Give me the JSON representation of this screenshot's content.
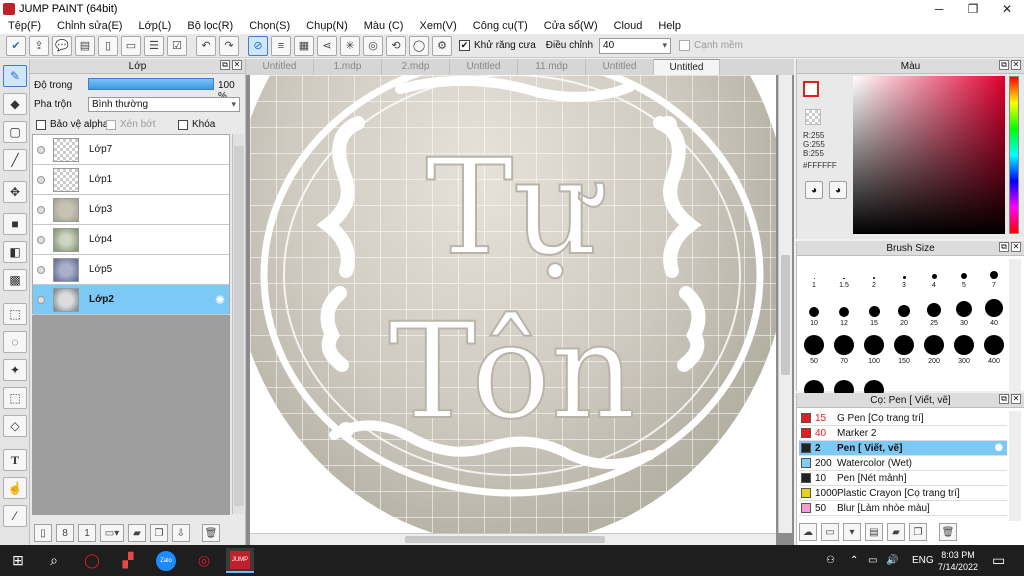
{
  "window": {
    "title": "JUMP PAINT (64bit)",
    "controls": [
      "─",
      "❐",
      "✕"
    ]
  },
  "menu": [
    "Tệp(F)",
    "Chỉnh sửa(E)",
    "Lớp(L)",
    "Bộ lọc(R)",
    "Chọn(S)",
    "Chụp(N)",
    "Màu (C)",
    "Xem(V)",
    "Công cụ(T)",
    "Cửa sổ(W)",
    "Cloud",
    "Help"
  ],
  "toolbar": {
    "antialias_label": "Khử răng cưa",
    "adjust_label": "Điều chỉnh",
    "adjust_value": "40",
    "smooth_edge_label": "Cạnh mềm"
  },
  "layer_panel": {
    "title": "Lớp",
    "opacity_label": "Độ trong",
    "opacity_value": "100 %",
    "opacity_fraction": 1.0,
    "blend_label": "Pha trộn",
    "blend_value": "Bình thường",
    "protect_alpha": "Bảo vệ alpha",
    "clip": "Xén bớt",
    "lock": "Khóa",
    "layers": [
      {
        "name": "Lớp7",
        "selected": false
      },
      {
        "name": "Lớp1",
        "selected": false
      },
      {
        "name": "Lớp3",
        "selected": false
      },
      {
        "name": "Lớp4",
        "selected": false
      },
      {
        "name": "Lớp5",
        "selected": false
      },
      {
        "name": "Lớp2",
        "selected": true
      }
    ]
  },
  "doc_tabs": [
    "Untitled",
    "1.mdp",
    "2.mdp",
    "Untitled",
    "11.mdp",
    "Untitled",
    "Untitled"
  ],
  "canvas_text": {
    "line1": "Tự",
    "line2": "Tôn"
  },
  "color_panel": {
    "title": "Màu",
    "r": "R:255",
    "g": "G:255",
    "b": "B:255",
    "hex": "#FFFFFF",
    "primary_color": "#FFFFFF",
    "accent": "#E02020"
  },
  "brush_panel": {
    "title": "Brush Size",
    "sizes": [
      "1",
      "1.5",
      "2",
      "3",
      "4",
      "5",
      "7",
      "10",
      "12",
      "15",
      "20",
      "25",
      "30",
      "40",
      "50",
      "70",
      "100",
      "150",
      "200",
      "300",
      "400",
      "",
      "",
      ""
    ]
  },
  "pen_panel": {
    "title": "Cọ: Pen [ Viết, vẽ]",
    "items": [
      {
        "size": "15",
        "name": "G Pen [Cọ trang trí]",
        "color": "#e02020",
        "selected": false
      },
      {
        "size": "40",
        "name": "Marker 2",
        "color": "#e02020",
        "selected": false
      },
      {
        "size": "2",
        "name": "Pen [ Viết, vẽ]",
        "color": "#222222",
        "selected": true
      },
      {
        "size": "200",
        "name": "Watercolor (Wet)",
        "color": "#7fd0f0",
        "selected": false
      },
      {
        "size": "10",
        "name": "Pen [Nét mảnh]",
        "color": "#222222",
        "selected": false
      },
      {
        "size": "1000",
        "name": "Plastic Crayon [Cọ trang trí]",
        "color": "#e8d020",
        "selected": false
      },
      {
        "size": "50",
        "name": "Blur [Làm nhòe màu]",
        "color": "#f0a0d0",
        "selected": false
      }
    ]
  },
  "taskbar": {
    "lang": "ENG",
    "time": "8:03 PM",
    "date": "7/14/2022",
    "app_zalo": "Zalo",
    "app_jump": "JUMP"
  }
}
